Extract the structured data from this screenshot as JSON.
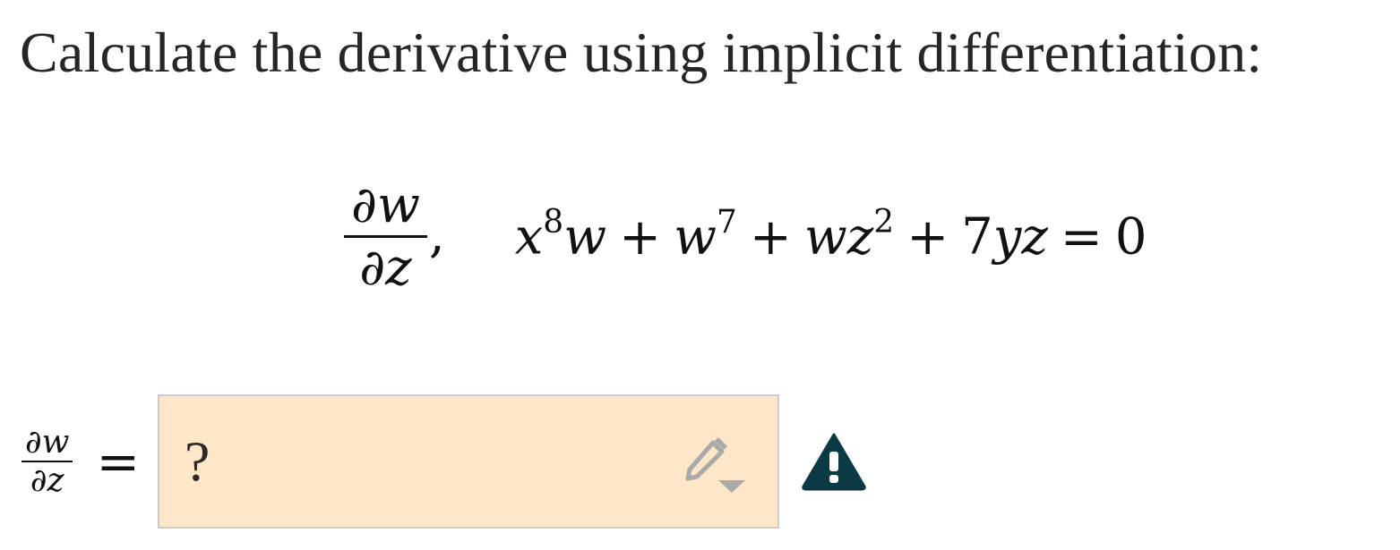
{
  "prompt": "Calculate the derivative using implicit differentiation:",
  "problem": {
    "derivative": {
      "numerator": "∂w",
      "denominator": "∂z"
    },
    "separator": ",",
    "equation": {
      "x": "x",
      "x_exp": "8",
      "w1": "w",
      "plus1": "+",
      "w2": "w",
      "w2_exp": "7",
      "plus2": "+",
      "wz_w": "w",
      "wz_z": "z",
      "z_exp": "2",
      "plus3": "+",
      "coef": "7",
      "yz": "yz",
      "equals": "=",
      "rhs": "0"
    }
  },
  "answer": {
    "label": {
      "numerator": "∂w",
      "denominator": "∂z"
    },
    "equals": "=",
    "value": "?",
    "edit_icon": "pencil-dropdown-icon",
    "status_icon": "warning-icon",
    "box_color": "#fde7c8",
    "warning_color": "#0b3a44"
  }
}
